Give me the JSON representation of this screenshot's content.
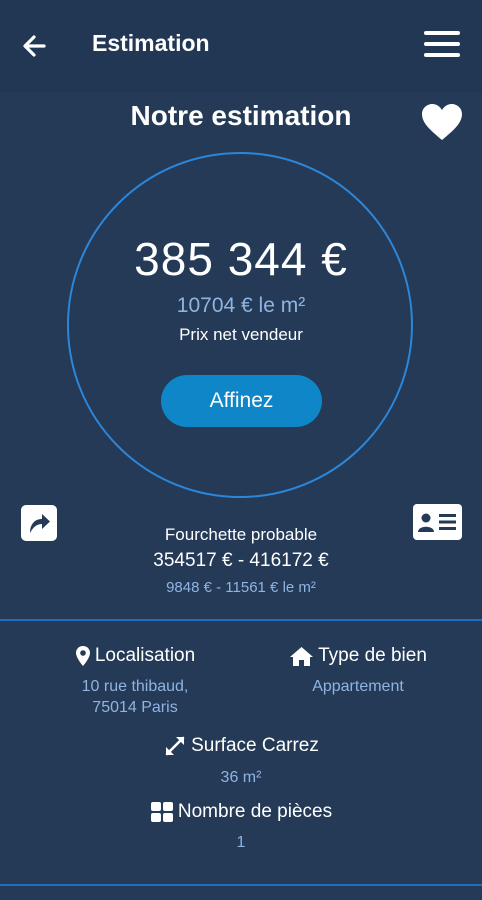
{
  "header": {
    "title": "Estimation"
  },
  "estimate": {
    "heading": "Notre estimation",
    "price": "385 344 €",
    "price_per_m2": "10704 € le m²",
    "caption": "Prix net vendeur",
    "refine_label": "Affinez"
  },
  "range": {
    "label": "Fourchette probable",
    "value": "354517 € - 416172 €",
    "per_m2": "9848 € - 11561 € le m²"
  },
  "details": {
    "location": {
      "label": "Localisation",
      "line1": "10 rue thibaud,",
      "line2": "75014 Paris"
    },
    "property_type": {
      "label": "Type de bien",
      "value": "Appartement"
    },
    "surface": {
      "label": "Surface Carrez",
      "value": "36 m²"
    },
    "rooms": {
      "label": "Nombre de pièces",
      "value": "1"
    }
  },
  "colors": {
    "background": "#243a57",
    "accent": "#2c86d9",
    "button": "#0e86c7",
    "muted_text": "#8fb4e2"
  },
  "icons": [
    "arrow-left-icon",
    "hamburger-menu-icon",
    "heart-icon",
    "share-icon",
    "id-card-icon",
    "map-pin-icon",
    "home-icon",
    "expand-icon",
    "grid-icon"
  ]
}
